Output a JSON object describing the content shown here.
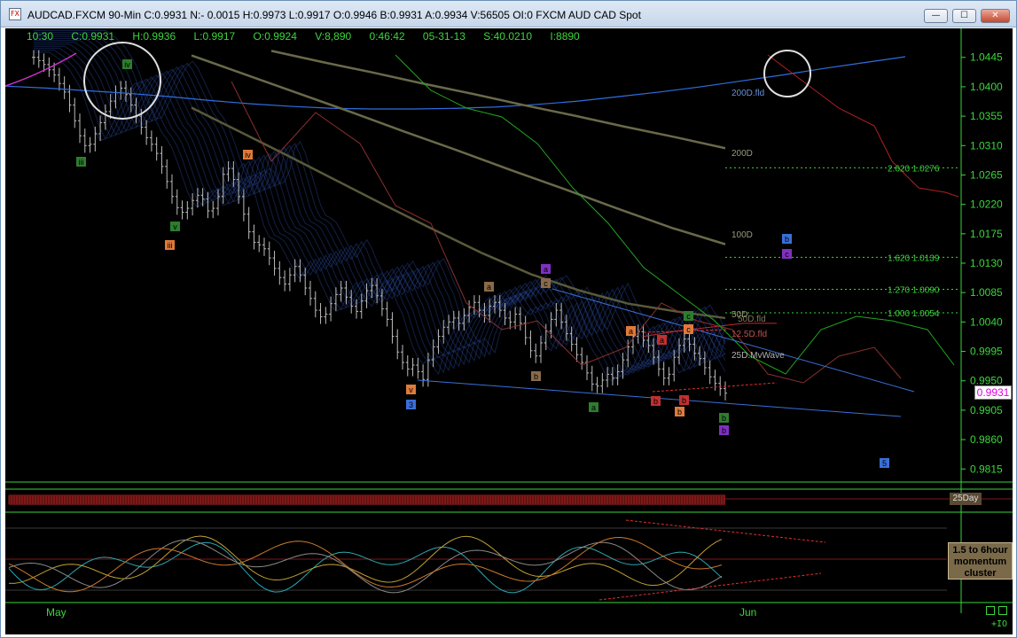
{
  "window": {
    "title": "AUDCAD.FXCM 90-Min C:0.9931 N:- 0.0015 H:0.9973 L:0.9917 O:0.9946 B:0.9931 A:0.9934 V:56505 OI:0 FXCM AUD CAD Spot",
    "icon_label": "FX",
    "btn_min": "—",
    "btn_max": "☐",
    "btn_close": "✕"
  },
  "info_bar": {
    "time": "10:30",
    "close": "C:0.9931",
    "high": "H:0.9936",
    "low": "L:0.9917",
    "open": "O:0.9924",
    "volume": "V:8,890",
    "elapsed": "0:46:42",
    "date": "05-31-13",
    "s_value": "S:40.0210",
    "i_value": "I:8890"
  },
  "chart_data": {
    "type": "line",
    "title": "AUDCAD.FXCM 90-Min",
    "colors": {
      "price": "#bdbdbd",
      "ma200d": "#2f6fe0",
      "ma200": "#6a6a4a",
      "ma100": "#6a6a4a",
      "ma50": "#5a5a3a",
      "red_line": "#c02a2a",
      "green_line": "#1fa81f",
      "magenta": "#cc33cc",
      "axis": "#3cd53c",
      "fib": "#3cd53c",
      "channel": "#3a6fd8"
    },
    "y_axis": {
      "ylim": [
        0.9795,
        1.0465
      ],
      "ticks": [
        "1.0445",
        "1.0400",
        "1.0355",
        "1.0310",
        "1.0265",
        "1.0220",
        "1.0175",
        "1.0130",
        "1.0085",
        "1.0040",
        "0.9995",
        "0.9950",
        "0.9905",
        "0.9860",
        "0.9815"
      ],
      "last_price": "0.9931"
    },
    "x_axis": {
      "months": [
        "May",
        "Jun"
      ]
    },
    "bars": [
      1.0445,
      1.044,
      1.0434,
      1.0426,
      1.0418,
      1.0405,
      1.0392,
      1.0372,
      1.0348,
      1.0325,
      1.031,
      1.0312,
      1.0328,
      1.0345,
      1.0362,
      1.0378,
      1.0391,
      1.0398,
      1.0388,
      1.0372,
      1.0355,
      1.0338,
      1.0322,
      1.0312,
      1.0298,
      1.0278,
      1.0255,
      1.0232,
      1.0215,
      1.0208,
      1.0214,
      1.0226,
      1.0234,
      1.0228,
      1.021,
      1.0214,
      1.0232,
      1.0266,
      1.0275,
      1.0258,
      1.0232,
      1.0205,
      1.0178,
      1.0162,
      1.0158,
      1.0152,
      1.0138,
      1.0122,
      1.0108,
      1.0098,
      1.0112,
      1.0125,
      1.0112,
      1.0092,
      1.0076,
      1.0058,
      1.0048,
      1.0052,
      1.0068,
      1.0082,
      1.0092,
      1.0078,
      1.0064,
      1.0056,
      1.0072,
      1.0088,
      1.0096,
      1.008,
      1.006,
      1.0044,
      1.0018,
      0.9994,
      0.9978,
      0.9968,
      0.9974,
      0.9964,
      0.9952,
      0.9982,
      1.0002,
      1.0018,
      1.0032,
      1.004,
      1.0046,
      1.0038,
      1.005,
      1.0062,
      1.007,
      1.0058,
      1.005,
      1.0064,
      1.007,
      1.0058,
      1.0046,
      1.004,
      1.0052,
      1.0038,
      1.0016,
      0.9996,
      0.9988,
      1.0008,
      1.0026,
      1.0044,
      1.0058,
      1.004,
      1.0022,
      1.0006,
      0.999,
      0.9978,
      0.9962,
      0.9945,
      0.9942,
      0.9951,
      0.996,
      0.9954,
      0.9964,
      0.9982,
      1.0002,
      1.0018,
      1.0025,
      1.0012,
      1.0004,
      0.9986,
      0.9968,
      0.9954,
      0.996,
      0.9986,
      1.0004,
      1.0014,
      1.0006,
      0.9992,
      0.9984,
      0.997,
      0.9956,
      0.9946,
      0.9938,
      0.9931
    ],
    "moving_averages": [
      {
        "name": "200D.fld",
        "values": [
          1.0401,
          1.0398,
          1.0394,
          1.039,
          1.0385,
          1.0379,
          1.0374,
          1.037,
          1.0367,
          1.0366,
          1.0366,
          1.0367,
          1.0369,
          1.0373,
          1.0378,
          1.0385,
          1.0392,
          1.04,
          1.0409,
          1.0418,
          1.0428,
          1.0437,
          1.0446
        ]
      },
      {
        "name": "200D",
        "values": [
          1.0455,
          1.0438,
          1.0422,
          1.0405,
          1.0389,
          1.0372,
          1.0356,
          1.0339,
          1.0323,
          1.0306
        ]
      },
      {
        "name": "100D",
        "values": [
          1.0448,
          1.0419,
          1.039,
          1.0361,
          1.0331,
          1.0302,
          1.0272,
          1.0243,
          1.0213,
          1.0184,
          1.0159
        ]
      },
      {
        "name": "50D",
        "values": [
          1.0368,
          1.0331,
          1.0294,
          1.0256,
          1.0218,
          1.0181,
          1.0145,
          1.0113,
          1.0088,
          1.0068,
          1.0056,
          1.0046
        ]
      },
      {
        "name": "12.5D.fld",
        "values": [
          1.0018,
          1.0026,
          1.0032,
          1.0038,
          1.0038
        ]
      },
      {
        "name": "25D.MvWave",
        "values": [
          0.9988
        ]
      }
    ],
    "fib_levels": [
      {
        "ratio": "2.620",
        "price": "1.0276",
        "value": 1.0276
      },
      {
        "ratio": "1.620",
        "price": "1.0139",
        "value": 1.0139
      },
      {
        "ratio": "1.270",
        "price": "1.0090",
        "value": 1.009
      },
      {
        "ratio": "1.000",
        "price": "1.0054",
        "value": 1.0054
      }
    ],
    "wave_labels": [
      "iv",
      "iii",
      "v",
      "iii",
      "iv",
      "v",
      "3",
      "a",
      "c",
      "b",
      "a",
      "a",
      "a",
      "b",
      "b",
      "c",
      "a",
      "b",
      "c",
      "b",
      "b",
      "c",
      "b",
      "4",
      "c",
      "5"
    ],
    "annotations": {
      "channel_label_200d_fld": "200D.fld",
      "label_200d": "200D",
      "label_100d": "100D",
      "label_50d": "50D",
      "label_50d_fld": "50D.fld",
      "label_12_5d_fld": "12.5D.fld",
      "label_25d_mvwave": "25D.MvWave"
    },
    "grid": false,
    "legend": "none"
  },
  "lower_panel": {
    "band_label": "25Day",
    "momentum_label_1": "1.5 to 6hour",
    "momentum_label_2": "momentum",
    "momentum_label_3": "cluster"
  },
  "footer": {
    "may": "May",
    "jun": "Jun",
    "io": "+IO"
  }
}
